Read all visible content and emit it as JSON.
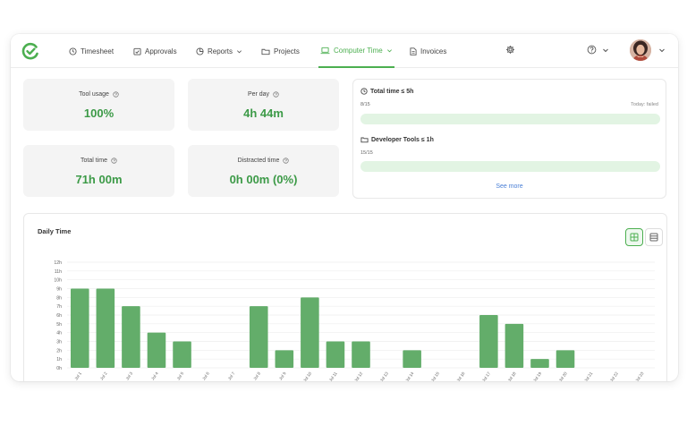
{
  "nav": {
    "items": [
      {
        "name": "nav-timesheet",
        "label": "Timesheet",
        "icon": "clock-icon",
        "active": false
      },
      {
        "name": "nav-approvals",
        "label": "Approvals",
        "icon": "check-calendar-icon",
        "active": false
      },
      {
        "name": "nav-reports",
        "label": "Reports",
        "icon": "pie-chart-icon",
        "active": false,
        "dropdown": true
      },
      {
        "name": "nav-projects",
        "label": "Projects",
        "icon": "folder-icon",
        "active": false
      },
      {
        "name": "nav-computer-time",
        "label": "Computer Time",
        "icon": "laptop-icon",
        "active": true,
        "dropdown": true
      },
      {
        "name": "nav-invoices",
        "label": "Invoices",
        "icon": "document-icon",
        "active": false
      }
    ]
  },
  "stats": {
    "tool_usage": {
      "label": "Tool usage",
      "value": "100%"
    },
    "per_day": {
      "label": "Per day",
      "value": "4h 44m"
    },
    "total_time": {
      "label": "Total time",
      "value": "71h 00m"
    },
    "distracted_time": {
      "label": "Distracted time",
      "value": "0h 00m (0%)"
    }
  },
  "rules": {
    "total_time_rule": {
      "title": "Total time ≤ 5h",
      "progress": "8/15",
      "progress_fraction": 0.533,
      "today_label": "Today:",
      "today_status": "failed"
    },
    "developer_tools_rule": {
      "title": "Developer Tools ≤ 1h",
      "progress": "15/15",
      "progress_fraction": 1.0
    },
    "see_more": "See more"
  },
  "colors": {
    "accent": "#4caf50",
    "bar": "#63ad6a",
    "value_text": "#3c9a47",
    "bar_bg": "#e2f4e3",
    "link": "#4a7fd6"
  },
  "chart_data": {
    "type": "bar",
    "title": "Daily Time",
    "categories": [
      "Jul 1",
      "Jul 2",
      "Jul 3",
      "Jul 4",
      "Jul 5",
      "Jul 6",
      "Jul 7",
      "Jul 8",
      "Jul 9",
      "Jul 10",
      "Jul 11",
      "Jul 12",
      "Jul 13",
      "Jul 14",
      "Jul 15",
      "Jul 16",
      "Jul 17",
      "Jul 18",
      "Jul 19",
      "Jul 20",
      "Jul 21",
      "Jul 22",
      "Jul 23"
    ],
    "values": [
      9,
      9,
      7,
      4,
      3,
      0,
      0,
      7,
      2,
      8,
      3,
      3,
      0,
      2,
      0,
      0,
      6,
      5,
      1,
      2,
      0,
      0,
      0
    ],
    "y_ticks": [
      "0h",
      "1h",
      "2h",
      "3h",
      "4h",
      "5h",
      "6h",
      "7h",
      "8h",
      "9h",
      "10h",
      "11h",
      "12h"
    ],
    "ylim": [
      0,
      12
    ],
    "grid": true
  }
}
